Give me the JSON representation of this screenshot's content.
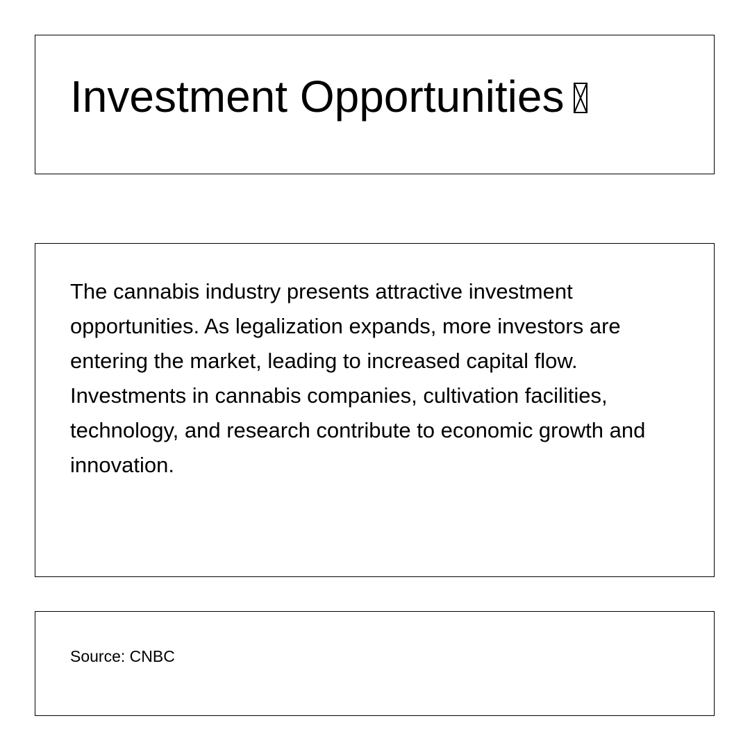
{
  "slide": {
    "title": "Investment Opportunities",
    "title_icon": "missing-glyph-icon",
    "body": "The cannabis industry presents attractive investment opportunities. As legalization expands, more investors are entering the market, leading to increased capital flow. Investments in cannabis companies, cultivation facilities, technology, and research contribute to economic growth and innovation.",
    "source": "Source: CNBC"
  },
  "colors": {
    "background": "#ffffff",
    "text": "#000000",
    "border": "#000000"
  }
}
